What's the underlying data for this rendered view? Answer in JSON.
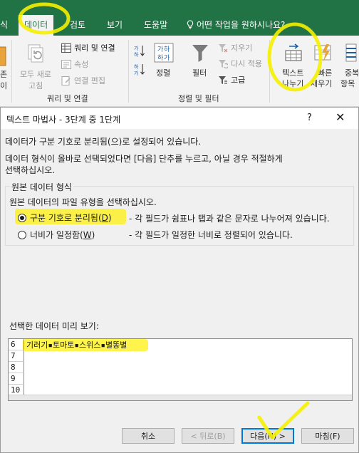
{
  "ribbon_tabs": {
    "cut_tab": "식",
    "data_tab": "데이터",
    "review_tab": "검토",
    "view_tab": "보기",
    "help_tab": "도움말",
    "tell_me": "어떤 작업을 원하시나요?"
  },
  "ribbon": {
    "left_cut_top": "존",
    "left_cut_bottom": "이",
    "refresh_all_line1": "모두 새로",
    "refresh_all_line2": "고침",
    "queries_connections": "쿼리 및 연결",
    "properties": "속성",
    "edit_links": "연결 편집",
    "group_queries": "쿼리 및 연결",
    "sort": "정렬",
    "filter": "필터",
    "clear": "지우기",
    "reapply": "다시 적용",
    "advanced": "고급",
    "group_sort_filter": "정렬 및 필터",
    "text_to_columns_line1": "텍스트",
    "text_to_columns_line2": "나누기",
    "flash_fill_line1": "빠른",
    "flash_fill_line2": "채우기",
    "remove_dup_line1": "중복",
    "remove_dup_line2": "항목"
  },
  "dialog": {
    "title": "텍스트 마법사 - 3단계 중 1단계",
    "help_glyph": "?",
    "close_glyph": "✕",
    "intro_line": "데이터가 구분 기호로 분리됨(으)로 설정되어 있습니다.",
    "instruction_line1": "데이터 형식이 올바로 선택되었다면 [다음] 단추를 누르고, 아닐 경우 적절하게",
    "instruction_line2": "선택하십시오.",
    "group_title": "원본 데이터 형식",
    "group_prompt": "원본 데이터의 파일 유형을 선택하십시오.",
    "option_delimited": "구분 기호로 분리됨(",
    "option_delimited_key": "D",
    "option_close_paren": ")",
    "option_delimited_desc": "- 각 필드가 쉼표나 탭과 같은 문자로 나누어져 있습니다.",
    "option_fixed": "너비가 일정함(",
    "option_fixed_key": "W",
    "option_fixed_desc": "- 각 필드가 일정한 너비로 정렬되어 있습니다.",
    "preview_label": "선택한 데이터 미리 보기:",
    "preview_rows": [
      {
        "num": "6",
        "text": "기러기▪토마토▪스위스▪별똥별"
      },
      {
        "num": "7",
        "text": ""
      },
      {
        "num": "8",
        "text": ""
      },
      {
        "num": "9",
        "text": ""
      },
      {
        "num": "10",
        "text": ""
      }
    ],
    "btn_cancel": "취소",
    "btn_back": "< 뒤로(B)",
    "btn_next": "다음(N) >",
    "btn_finish": "마침(F)"
  },
  "colors": {
    "excel_green": "#217346",
    "highlighter": "#fff000"
  }
}
